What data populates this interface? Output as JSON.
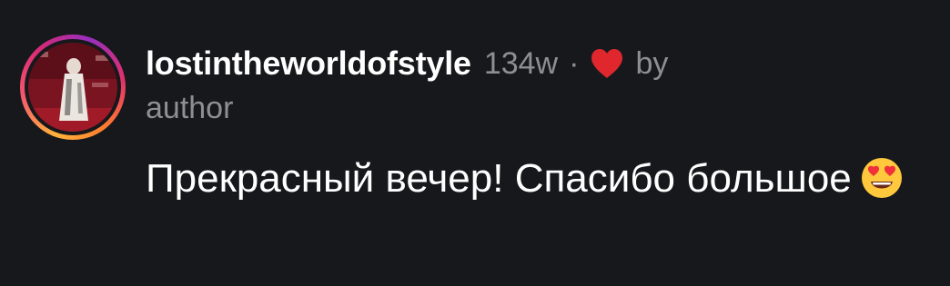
{
  "comment": {
    "username": "lostintheworldofstyle",
    "time": "134w",
    "separator": "·",
    "liked_by_word": "by",
    "liked_by_author": "author",
    "text": "Прекрасный вечер! Спасибо большое",
    "emoji_name": "smiling-face-with-heart-eyes",
    "heart_icon": "heart-icon",
    "colors": {
      "background": "#17181c",
      "username": "#ffffff",
      "meta": "#8e8e93",
      "heart": "#e0272e",
      "text": "#ffffff"
    }
  }
}
